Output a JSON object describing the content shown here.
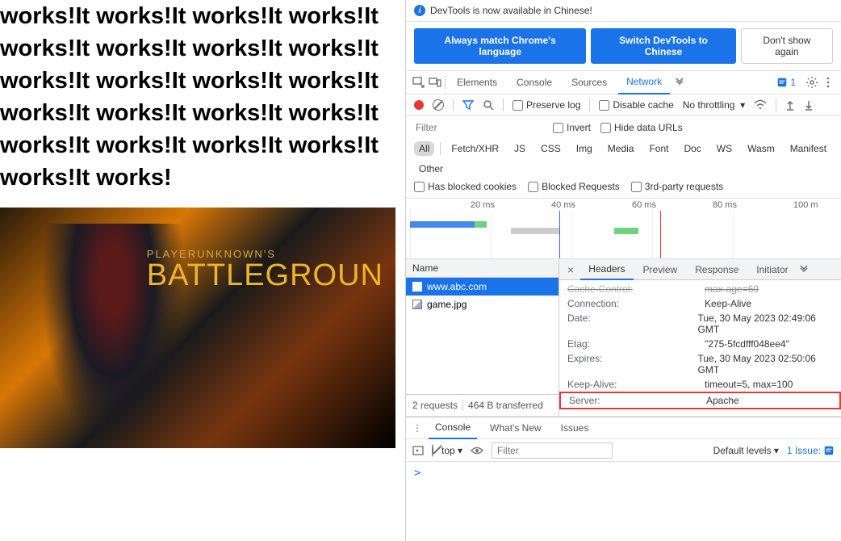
{
  "page": {
    "repeated_text": "works!It works!It works!It works!It works!It works!It works!It works!It works!It works!It works!It works!It works!It works!It works!It works!It works!It works!It works!It works!It works!It works!",
    "game_subtitle": "PLAYERUNKNOWN'S",
    "game_title": "BATTLEGROUN"
  },
  "notice": {
    "text": "DevTools is now available in Chinese!",
    "btn_match": "Always match Chrome's language",
    "btn_switch": "Switch DevTools to Chinese",
    "btn_dismiss": "Don't show again"
  },
  "tabs": {
    "elements": "Elements",
    "console": "Console",
    "sources": "Sources",
    "network": "Network",
    "issues_count": "1"
  },
  "net": {
    "preserve": "Preserve log",
    "disable_cache": "Disable cache",
    "throttling": "No throttling"
  },
  "filter": {
    "placeholder": "Filter",
    "invert": "Invert",
    "hide_data": "Hide data URLs"
  },
  "types": {
    "all": "All",
    "fetch": "Fetch/XHR",
    "js": "JS",
    "css": "CSS",
    "img": "Img",
    "media": "Media",
    "font": "Font",
    "doc": "Doc",
    "ws": "WS",
    "wasm": "Wasm",
    "manifest": "Manifest",
    "other": "Other"
  },
  "extra": {
    "blocked_cookies": "Has blocked cookies",
    "blocked_req": "Blocked Requests",
    "third_party": "3rd-party requests"
  },
  "timeline": {
    "t1": "20 ms",
    "t2": "40 ms",
    "t3": "60 ms",
    "t4": "80 ms",
    "t5": "100 m"
  },
  "requests": {
    "header": "Name",
    "r1": "www.abc.com",
    "r2": "game.jpg",
    "status_count": "2 requests",
    "status_size": "464 B transferred"
  },
  "details_tabs": {
    "headers": "Headers",
    "preview": "Preview",
    "response": "Response",
    "initiator": "Initiator"
  },
  "headers": {
    "cache_k": "Cache-Control:",
    "cache_v": "max-age=60",
    "conn_k": "Connection:",
    "conn_v": "Keep-Alive",
    "date_k": "Date:",
    "date_v": "Tue, 30 May 2023 02:49:06 GMT",
    "etag_k": "Etag:",
    "etag_v": "\"275-5fcdfff048ee4\"",
    "expires_k": "Expires:",
    "expires_v": "Tue, 30 May 2023 02:50:06 GMT",
    "ka_k": "Keep-Alive:",
    "ka_v": "timeout=5, max=100",
    "server_k": "Server:",
    "server_v": "Apache"
  },
  "console_tabs": {
    "console": "Console",
    "whatsnew": "What's New",
    "issues": "Issues"
  },
  "console_bar": {
    "top": "top ▾",
    "filter_ph": "Filter",
    "levels": "Default levels ▾",
    "issue_link": "1 Issue:"
  },
  "prompt": ">"
}
